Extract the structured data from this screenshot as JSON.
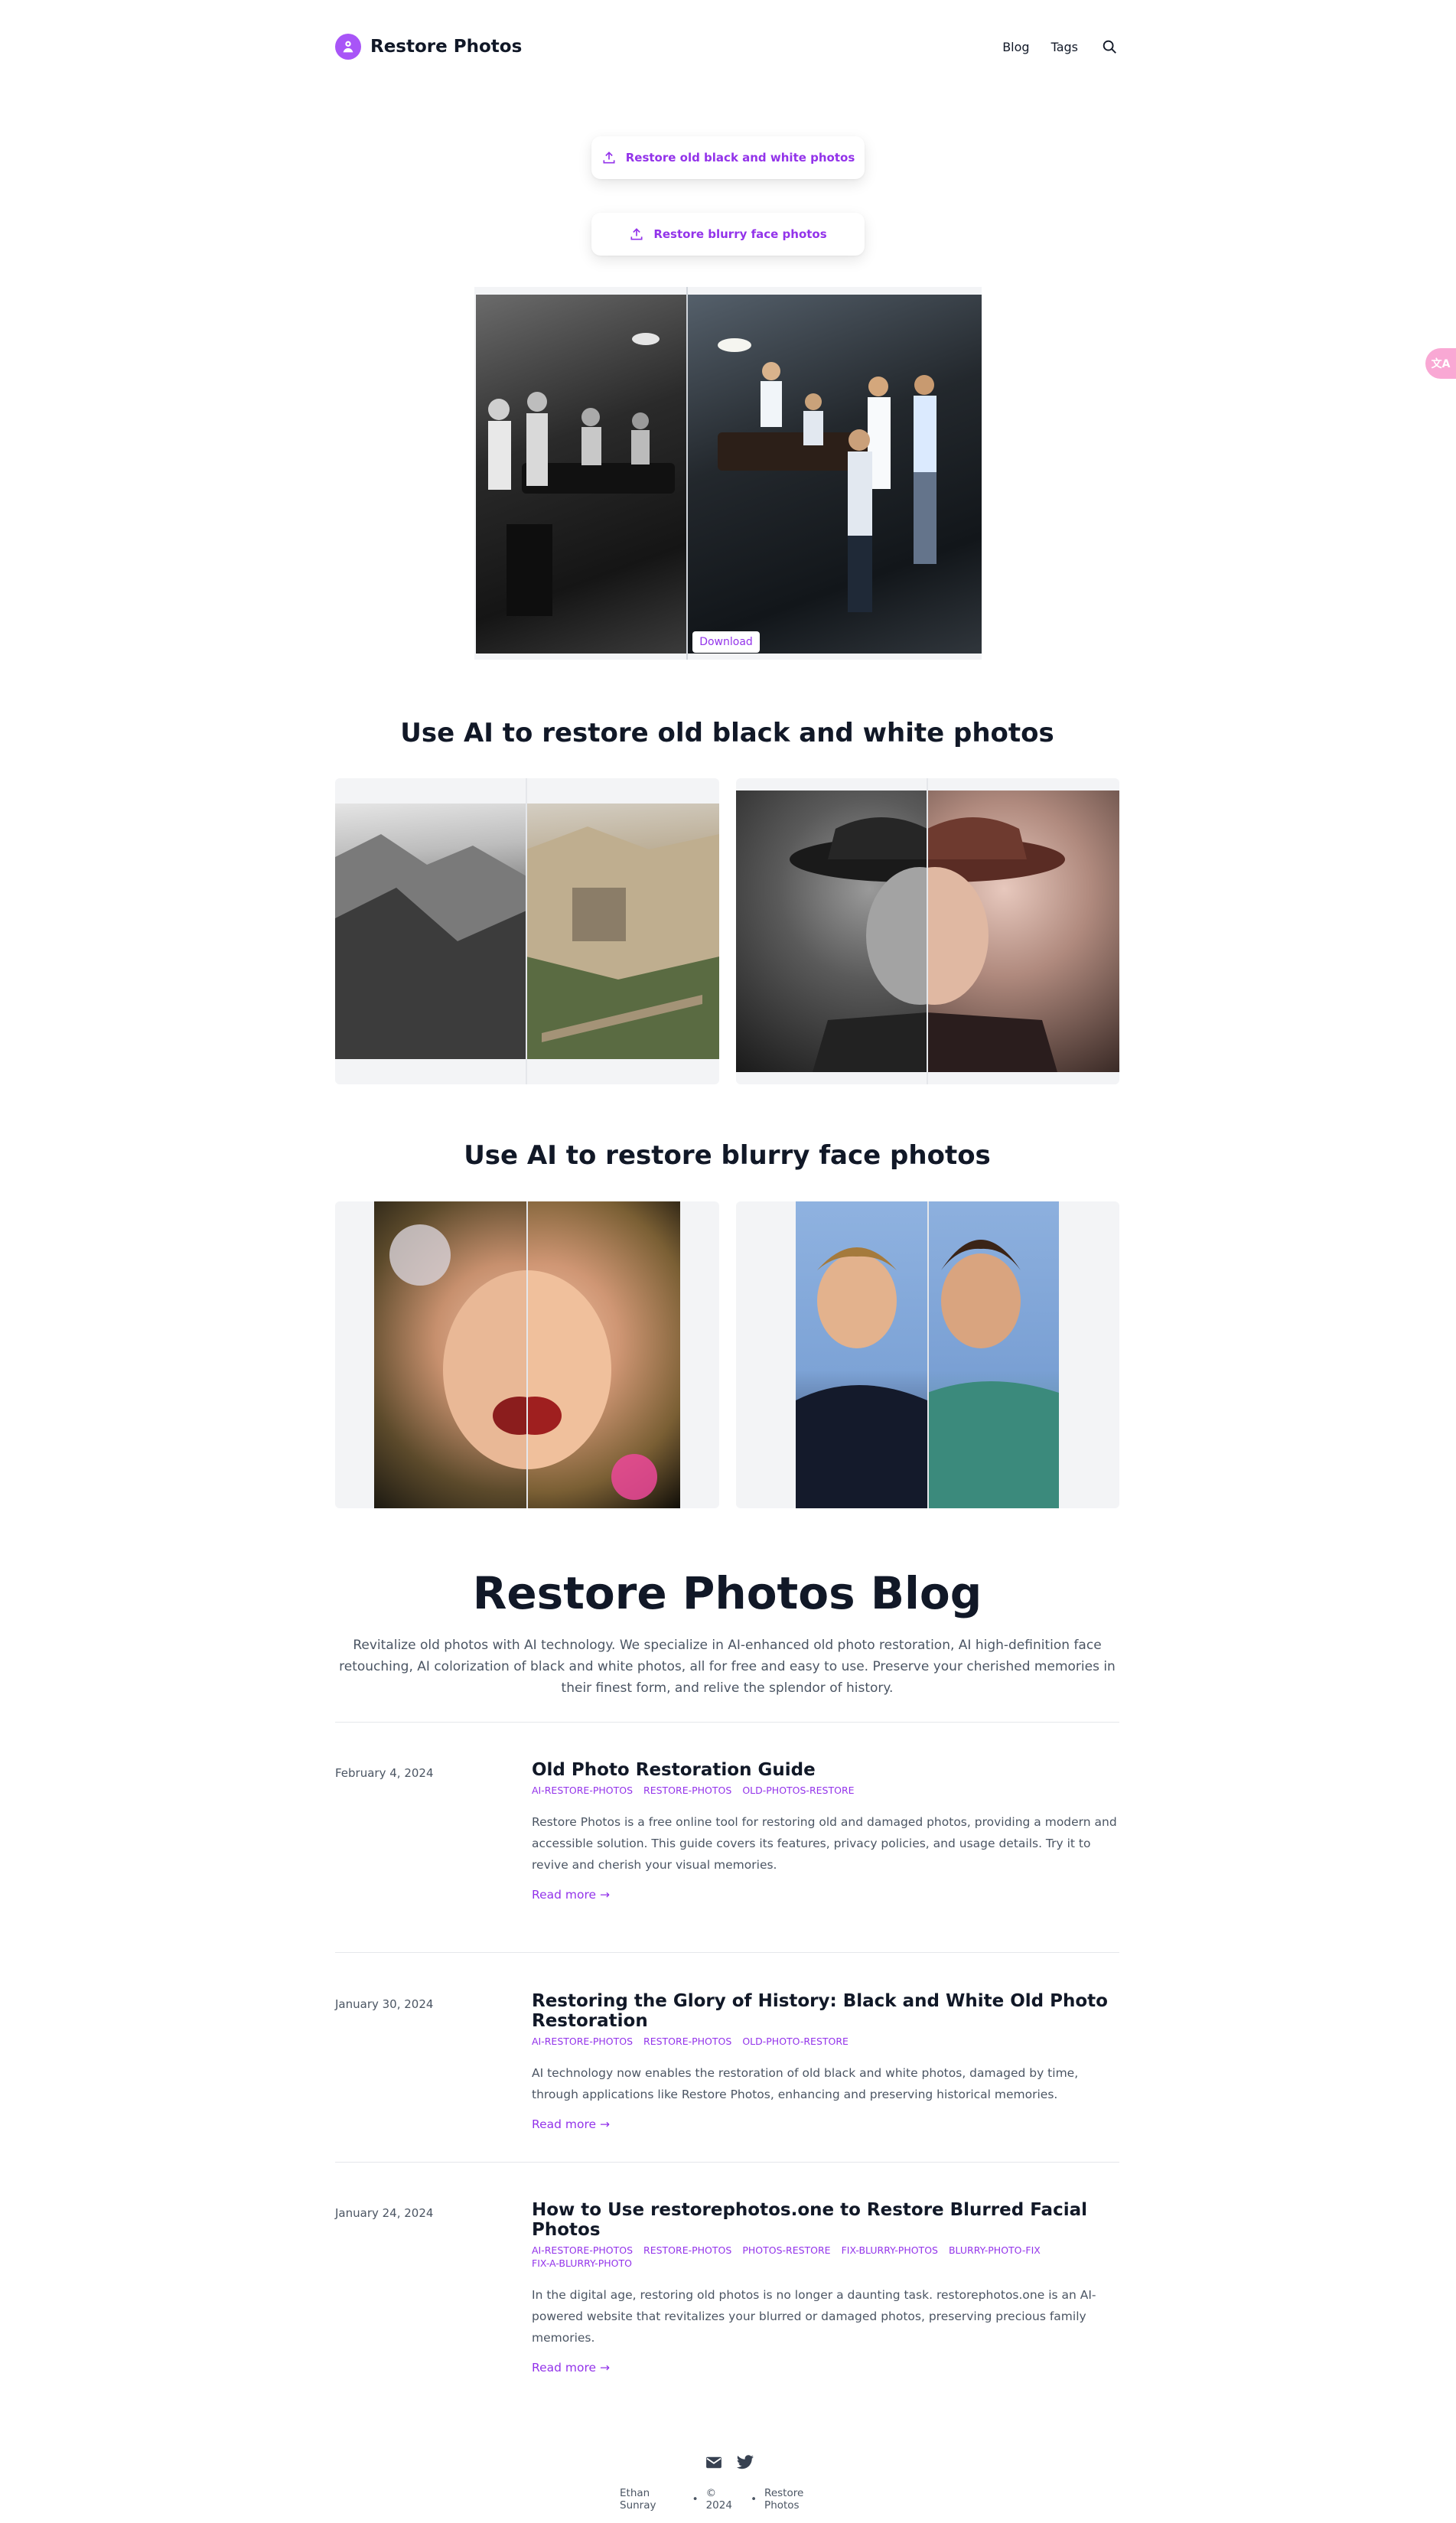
{
  "header": {
    "site_name": "Restore Photos",
    "nav": [
      {
        "label": "Blog"
      },
      {
        "label": "Tags"
      }
    ]
  },
  "hero": {
    "upload_bw_label": "Restore old black and white photos",
    "upload_blurry_label": "Restore blurry face photos",
    "download_label": "Download"
  },
  "sections": {
    "bw_heading": "Use AI to restore old black and white photos",
    "blurry_heading": "Use AI to restore blurry face photos"
  },
  "blog": {
    "title": "Restore Photos Blog",
    "intro": "Revitalize old photos with AI technology. We specialize in AI-enhanced old photo restoration, AI high-definition face retouching, AI colorization of black and white photos, all for free and easy to use. Preserve your cherished memories in their finest form, and relive the splendor of history.",
    "read_more": "Read more →",
    "posts": [
      {
        "date": "February 4, 2024",
        "title": "Old Photo Restoration Guide",
        "tags": [
          "AI-RESTORE-PHOTOS",
          "RESTORE-PHOTOS",
          "OLD-PHOTOS-RESTORE"
        ],
        "summary": "Restore Photos is a free online tool for restoring old and damaged photos, providing a modern and accessible solution. This guide covers its features, privacy policies, and usage details. Try it to revive and cherish your visual memories."
      },
      {
        "date": "January 30, 2024",
        "title": "Restoring the Glory of History: Black and White Old Photo Restoration",
        "tags": [
          "AI-RESTORE-PHOTOS",
          "RESTORE-PHOTOS",
          "OLD-PHOTO-RESTORE"
        ],
        "summary": "AI technology now enables the restoration of old black and white photos, damaged by time, through applications like Restore Photos, enhancing and preserving historical memories."
      },
      {
        "date": "January 24, 2024",
        "title": "How to Use restorephotos.one to Restore Blurred Facial Photos",
        "tags": [
          "AI-RESTORE-PHOTOS",
          "RESTORE-PHOTOS",
          "PHOTOS-RESTORE",
          "FIX-BLURRY-PHOTOS",
          "BLURRY-PHOTO-FIX",
          "FIX-A-BLURRY-PHOTO"
        ],
        "summary": "In the digital age, restoring old photos is no longer a daunting task. restorephotos.one is an AI-powered website that revitalizes your blurred or damaged photos, preserving precious family memories."
      }
    ]
  },
  "footer": {
    "author": "Ethan Sunray",
    "bullet": "•",
    "copyright": "© 2024",
    "site": "Restore Photos"
  },
  "translate_badge": "文A",
  "colors": {
    "accent": "#9333ea",
    "logo": "#a855f7",
    "text": "#111827",
    "muted": "#4b5563"
  },
  "icons": [
    "logo-icon",
    "search-icon",
    "upload-icon",
    "mail-icon",
    "twitter-icon",
    "translate-icon"
  ]
}
